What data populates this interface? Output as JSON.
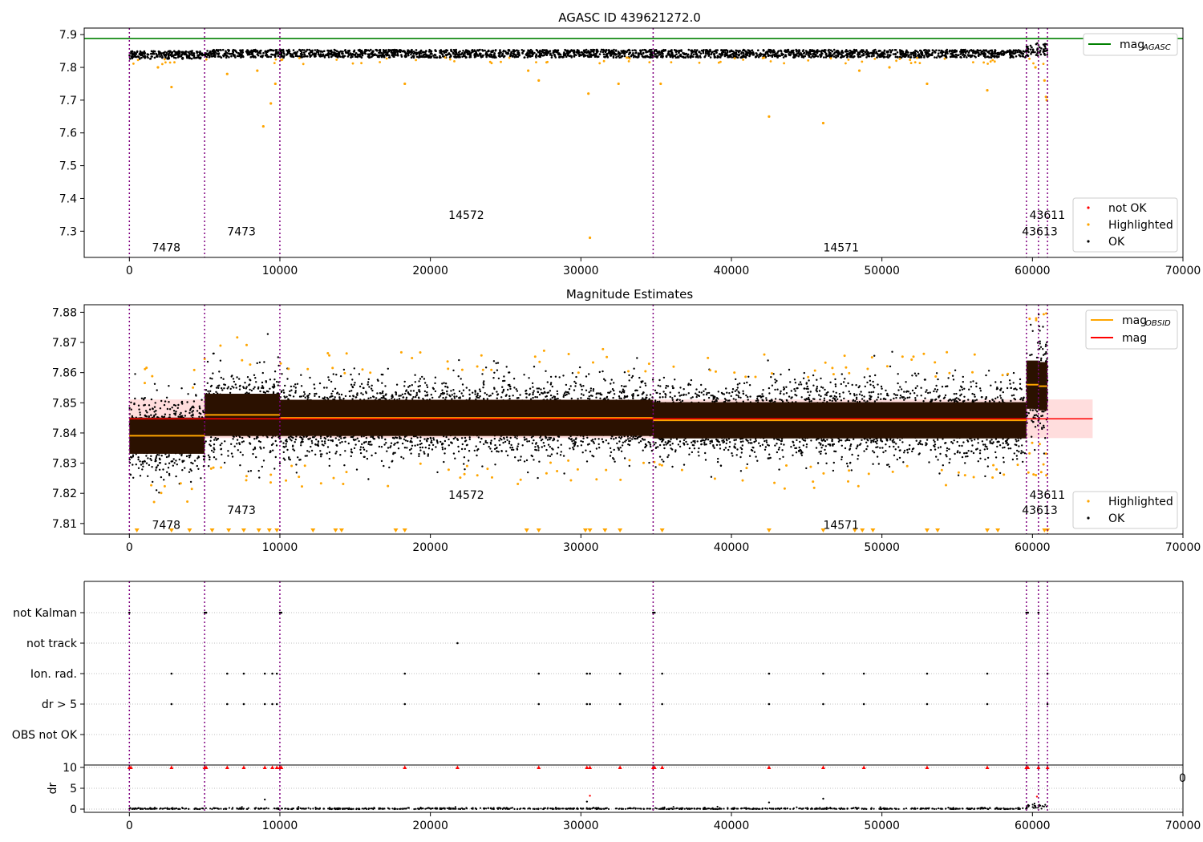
{
  "chart_data": [
    {
      "type": "scatter",
      "title": "AGASC ID 439621272.0",
      "xlim": [
        -3000,
        70000
      ],
      "ylim": [
        7.22,
        7.92
      ],
      "xticks": [
        0,
        10000,
        20000,
        30000,
        40000,
        50000,
        60000,
        70000
      ],
      "xtick_labels": [
        "0",
        "10000",
        "20000",
        "30000",
        "40000",
        "50000",
        "60000",
        "70000"
      ],
      "yticks": [
        7.3,
        7.4,
        7.5,
        7.6,
        7.7,
        7.8,
        7.9
      ],
      "ytick_labels": [
        "7.3",
        "7.4",
        "7.5",
        "7.6",
        "7.7",
        "7.8",
        "7.9"
      ],
      "mag_agasc": 7.888,
      "obsid_boundaries": [
        0,
        5000,
        10000,
        34800,
        59600,
        60400,
        61000
      ],
      "obsid_labels": [
        {
          "text": "7478",
          "x": 1500,
          "y": 7.25
        },
        {
          "text": "7473",
          "x": 6500,
          "y": 7.3
        },
        {
          "text": "14572",
          "x": 21200,
          "y": 7.35
        },
        {
          "text": "14571",
          "x": 46100,
          "y": 7.25
        },
        {
          "text": "43613",
          "x": 59300,
          "y": 7.3
        },
        {
          "text": "43611",
          "x": 59800,
          "y": 7.35
        }
      ],
      "series": [
        {
          "name": "OK",
          "color": "#000000",
          "band_mean": 7.842,
          "band_halfwidth": 0.012,
          "x_range": [
            0,
            61000
          ]
        },
        {
          "name": "Highlighted",
          "color": "#ffa500",
          "points": [
            [
              2800,
              7.74
            ],
            [
              8900,
              7.62
            ],
            [
              9400,
              7.69
            ],
            [
              9700,
              7.75
            ],
            [
              18300,
              7.75
            ],
            [
              27200,
              7.76
            ],
            [
              30500,
              7.72
            ],
            [
              30600,
              7.28
            ],
            [
              32500,
              7.75
            ],
            [
              35300,
              7.75
            ],
            [
              42500,
              7.65
            ],
            [
              46100,
              7.63
            ],
            [
              53000,
              7.75
            ],
            [
              57000,
              7.73
            ],
            [
              60900,
              7.71
            ],
            [
              60950,
              7.7
            ],
            [
              60800,
              7.76
            ],
            [
              1900,
              7.8
            ],
            [
              6500,
              7.78
            ],
            [
              8500,
              7.79
            ],
            [
              26500,
              7.79
            ],
            [
              48500,
              7.79
            ],
            [
              50500,
              7.8
            ],
            [
              60200,
              7.8
            ]
          ]
        },
        {
          "name": "not OK",
          "color": "#ff0000",
          "points": []
        }
      ],
      "legends": [
        {
          "entries": [
            "mag_AGASC"
          ],
          "position": "top-right"
        },
        {
          "entries": [
            "not OK",
            "Highlighted",
            "OK"
          ],
          "position": "bottom-right"
        }
      ]
    },
    {
      "type": "scatter",
      "title": "Magnitude Estimates",
      "xlim": [
        -3000,
        70000
      ],
      "ylim": [
        7.8065,
        7.8825
      ],
      "xticks": [
        0,
        10000,
        20000,
        30000,
        40000,
        50000,
        60000,
        70000
      ],
      "xtick_labels": [
        "0",
        "10000",
        "20000",
        "30000",
        "40000",
        "50000",
        "60000",
        "70000"
      ],
      "yticks": [
        7.81,
        7.82,
        7.83,
        7.84,
        7.85,
        7.86,
        7.87,
        7.88
      ],
      "ytick_labels": [
        "7.81",
        "7.82",
        "7.83",
        "7.84",
        "7.85",
        "7.86",
        "7.87",
        "7.88"
      ],
      "mag": 7.8447,
      "mag_band": [
        7.8383,
        7.8511
      ],
      "mag_band_x": [
        0,
        64000
      ],
      "mag_obsid": [
        {
          "x": [
            0,
            5000
          ],
          "y": 7.8391,
          "std": 0.006
        },
        {
          "x": [
            5000,
            10000
          ],
          "y": 7.846,
          "std": 0.007
        },
        {
          "x": [
            10000,
            34800
          ],
          "y": 7.845,
          "std": 0.006
        },
        {
          "x": [
            34800,
            59600
          ],
          "y": 7.8442,
          "std": 0.006
        },
        {
          "x": [
            59600,
            60400
          ],
          "y": 7.856,
          "std": 0.008
        },
        {
          "x": [
            60400,
            61000
          ],
          "y": 7.8555,
          "std": 0.008
        }
      ],
      "obsid_boundaries": [
        0,
        5000,
        10000,
        34800,
        59600,
        60400,
        61000
      ],
      "obsid_labels": [
        {
          "text": "7478",
          "x": 1500,
          "y": 7.8095
        },
        {
          "text": "7473",
          "x": 6500,
          "y": 7.8145
        },
        {
          "text": "14572",
          "x": 21200,
          "y": 7.8195
        },
        {
          "text": "14571",
          "x": 46100,
          "y": 7.8095
        },
        {
          "text": "43613",
          "x": 59300,
          "y": 7.8145
        },
        {
          "text": "43611",
          "x": 59800,
          "y": 7.8195
        }
      ],
      "series": [
        {
          "name": "OK",
          "color": "#000000"
        },
        {
          "name": "Highlighted",
          "color": "#ffa500",
          "outliers_below_x": [
            500,
            2800,
            4000,
            5500,
            6600,
            7600,
            8600,
            9300,
            9800,
            12200,
            13700,
            14100,
            17700,
            18300,
            26400,
            27200,
            30300,
            30600,
            31600,
            32600,
            35400,
            42500,
            46100,
            48200,
            48700,
            49400,
            53000,
            53700,
            57000,
            57700,
            60800,
            61000
          ]
        }
      ],
      "legends": [
        {
          "entries": [
            "mag_OBSID",
            "mag"
          ],
          "position": "top-right"
        },
        {
          "entries": [
            "Highlighted",
            "OK"
          ],
          "position": "bottom-right"
        }
      ]
    },
    {
      "type": "scatter",
      "title": "",
      "xlim": [
        -3000,
        70000
      ],
      "categories": [
        "OBS not OK",
        "dr > 5",
        "Ion. rad.",
        "not track",
        "not Kalman"
      ],
      "flags": {
        "not Kalman": [
          0,
          5000,
          5100,
          10000,
          10100,
          34800,
          34900,
          59600,
          59700,
          60400
        ],
        "not track": [
          21800
        ],
        "Ion. rad.": [
          2800,
          6500,
          7600,
          9000,
          9500,
          9800,
          18300,
          27200,
          30400,
          30600,
          32600,
          35400,
          42500,
          46100,
          48800,
          53000,
          57000,
          61000
        ],
        "dr > 5": [
          2800,
          6500,
          7600,
          9000,
          9500,
          9800,
          18300,
          27200,
          30400,
          30600,
          32600,
          35400,
          42500,
          46100,
          48800,
          53000,
          57000,
          61000
        ],
        "OBS not OK": []
      },
      "dr_ylabel": "dr",
      "dr_ylim": [
        0,
        10
      ],
      "dr_yticks": [
        0,
        5,
        10
      ],
      "dr_ytick_labels": [
        "0",
        "5",
        "10"
      ],
      "dr_red_points_at_10": [
        0,
        100,
        5000,
        5100,
        10000,
        10100,
        2800,
        6500,
        7600,
        9000,
        9500,
        9800,
        18300,
        21800,
        27200,
        30400,
        30600,
        32600,
        34800,
        34900,
        35400,
        42500,
        46100,
        48800,
        53000,
        57000,
        59600,
        59700,
        60400,
        61000
      ],
      "dr_high_points": [
        [
          9000,
          2.3
        ],
        [
          30400,
          1.8
        ],
        [
          30600,
          3.2
        ],
        [
          42500,
          1.6
        ],
        [
          46100,
          2.5
        ],
        [
          60300,
          3.0
        ]
      ],
      "xticks": [
        0,
        10000,
        20000,
        30000,
        40000,
        50000,
        60000,
        70000
      ],
      "xtick_labels": [
        "0",
        "10000",
        "20000",
        "30000",
        "40000",
        "50000",
        "60000",
        "70000"
      ],
      "stray_label": "0"
    }
  ],
  "colors": {
    "ok": "#000000",
    "highlighted": "#ffa500",
    "not_ok": "#ff0000",
    "mag_agasc": "#008000",
    "mag": "#ff0000",
    "mag_obsid": "#ffa500",
    "mag_band": "#ffdddd",
    "obsid_line": "#800080"
  },
  "legend_text": {
    "mag": "mag",
    "agasc_sub": "AGASC",
    "obsid_sub": "OBSID",
    "not_ok": "not OK",
    "highlighted": "Highlighted",
    "ok": "OK"
  }
}
